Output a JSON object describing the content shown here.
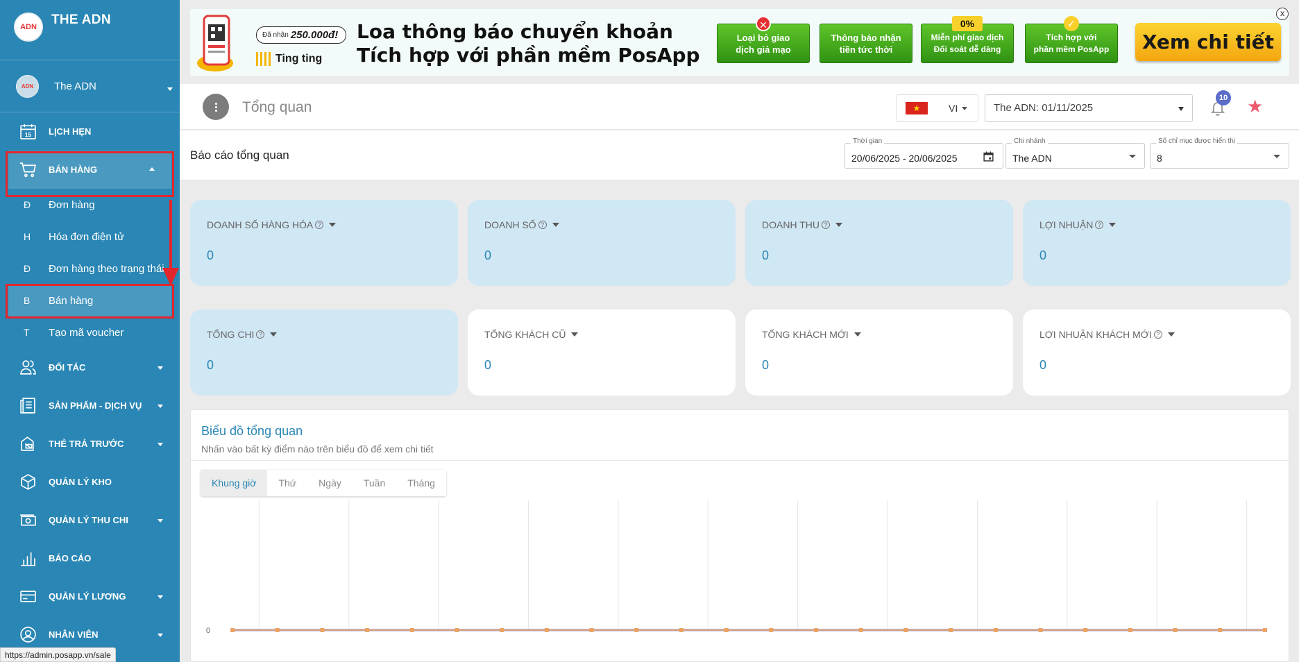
{
  "brand": {
    "name": "THE ADN",
    "logo_text": "ADN"
  },
  "account": {
    "name": "The ADN",
    "avatar_text": "ADN"
  },
  "sidebar": {
    "items": [
      {
        "id": "lich-hen",
        "label": "LỊCH HẸN",
        "icon": "calendar-icon",
        "icon_text": "15"
      },
      {
        "id": "ban-hang",
        "label": "BÁN HÀNG",
        "icon": "cart-icon"
      },
      {
        "id": "doi-tac",
        "label": "ĐỐI TÁC",
        "icon": "partners-icon"
      },
      {
        "id": "san-pham",
        "label": "SẢN PHẨM - DỊCH VỤ",
        "icon": "products-icon"
      },
      {
        "id": "the-tra-truoc",
        "label": "THẺ TRẢ TRƯỚC",
        "icon": "prepaid-card-icon"
      },
      {
        "id": "quan-ly-kho",
        "label": "QUẢN LÝ KHO",
        "icon": "box-icon"
      },
      {
        "id": "quan-ly-thu-chi",
        "label": "QUẢN LÝ THU CHI",
        "icon": "money-icon"
      },
      {
        "id": "bao-cao",
        "label": "BÁO CÁO",
        "icon": "bar-chart-icon"
      },
      {
        "id": "quan-ly-luong",
        "label": "QUẢN LÝ LƯƠNG",
        "icon": "salary-card-icon"
      },
      {
        "id": "nhan-vien",
        "label": "NHÂN VIÊN",
        "icon": "user-icon"
      }
    ],
    "submenu": [
      {
        "letter": "Đ",
        "label": "Đơn hàng"
      },
      {
        "letter": "H",
        "label": "Hóa đơn điện tử"
      },
      {
        "letter": "Đ",
        "label": "Đơn hàng theo trạng thái"
      },
      {
        "letter": "B",
        "label": "Bán hàng"
      },
      {
        "letter": "T",
        "label": "Tạo mã voucher"
      }
    ]
  },
  "status_url": "https://admin.posapp.vn/sale",
  "banner": {
    "reward_prefix": "Đã nhận",
    "reward_amount": "250.000đ!",
    "ting": "Ting ting",
    "title_line1": "Loa thông báo chuyển khoản",
    "title_line2": "Tích hợp với phần mềm PosApp",
    "features": [
      {
        "line1": "Loại bỏ giao",
        "line2": "dịch giả mạo",
        "badge": "✕"
      },
      {
        "line1": "Thông báo nhận",
        "line2": "tiền tức thời",
        "badge": "🔔"
      },
      {
        "line1": "Miễn phí giao dịch",
        "line2": "Đối soát dễ dàng",
        "badge": "0%"
      },
      {
        "line1": "Tích hợp với",
        "line2": "phần mềm PosApp",
        "badge": "✓"
      }
    ],
    "cta": "Xem chi tiết",
    "close": "x"
  },
  "header": {
    "title": "Tổng quan",
    "lang": "VI",
    "branch": "The ADN: 01/11/2025",
    "notifications": "10"
  },
  "report": {
    "title": "Báo cáo tổng quan",
    "time_label": "Thời gian",
    "time_value": "20/06/2025 - 20/06/2025",
    "branch_label": "Chi nhánh",
    "branch_value": "The ADN",
    "count_label": "Số chỉ mục được hiển thị",
    "count_value": "8"
  },
  "cards": [
    {
      "label": "DOANH SỐ HÀNG HÓA",
      "help": true,
      "value": "0",
      "highlight": true
    },
    {
      "label": "DOANH SỐ",
      "help": true,
      "value": "0",
      "highlight": true
    },
    {
      "label": "DOANH THU",
      "help": true,
      "value": "0",
      "highlight": true
    },
    {
      "label": "LỢI NHUẬN",
      "help": true,
      "value": "0",
      "highlight": true
    },
    {
      "label": "TỔNG CHI",
      "help": true,
      "value": "0",
      "highlight": true
    },
    {
      "label": "TỔNG KHÁCH CŨ",
      "help": false,
      "value": "0",
      "highlight": false
    },
    {
      "label": "TỔNG KHÁCH MỚI",
      "help": false,
      "value": "0",
      "highlight": false
    },
    {
      "label": "LỢI NHUẬN KHÁCH MỚI",
      "help": true,
      "value": "0",
      "highlight": false
    }
  ],
  "chart_panel": {
    "title": "Biểu đồ tổng quan",
    "subtitle": "Nhấn vào bất kỳ điểm nào trên biểu đồ để xem chi tiết",
    "tabs": [
      "Khung giờ",
      "Thứ",
      "Ngày",
      "Tuần",
      "Tháng"
    ],
    "active_tab": "Khung giờ"
  },
  "chart_data": {
    "type": "line",
    "y_tick_labels": [
      "0"
    ],
    "series_colors": [
      "#8c8fd6",
      "#f0a35a"
    ],
    "series": [
      {
        "values": [
          0,
          0,
          0,
          0,
          0,
          0,
          0,
          0,
          0,
          0,
          0,
          0,
          0,
          0,
          0,
          0,
          0,
          0,
          0,
          0,
          0,
          0,
          0,
          0
        ]
      },
      {
        "values": [
          0,
          0,
          0,
          0,
          0,
          0,
          0,
          0,
          0,
          0,
          0,
          0,
          0,
          0,
          0,
          0,
          0,
          0,
          0,
          0,
          0,
          0,
          0,
          0
        ]
      }
    ],
    "grid": true
  },
  "colors": {
    "sidebar": "#2a86b4",
    "accent": "#2a86b4",
    "card_highlight": "#d0e7f4",
    "annotation": "#e3262b"
  }
}
